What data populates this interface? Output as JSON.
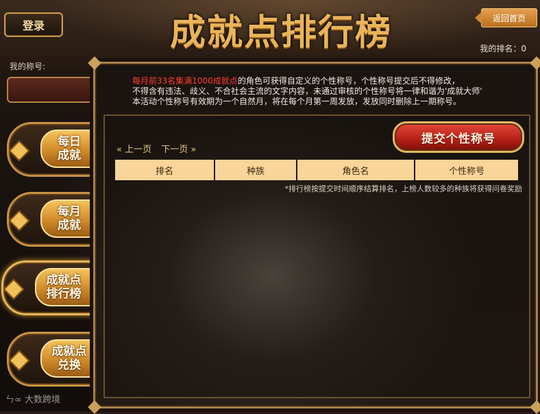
{
  "header": {
    "login_label": "登录",
    "title": "成就点排行榜",
    "home_label": "返回首页",
    "my_rank_label": "我的排名：",
    "my_rank_value": "0"
  },
  "sidebar": {
    "my_title_label": "我的称号:",
    "items": [
      {
        "line1": "每日",
        "line2": "成就"
      },
      {
        "line1": "每月",
        "line2": "成就"
      },
      {
        "line1": "成就点",
        "line2": "排行榜"
      },
      {
        "line1": "成就点",
        "line2": "兑换"
      }
    ]
  },
  "notice": {
    "highlight": "每月前33名集满1000成就点",
    "text1": "的角色可获得自定义的个性称号，个性称号提交后不得修改，",
    "line2": "不得含有违法、歧义、不合社会主流的文字内容，未通过审核的个性称号将一律和谐为'成就大师'",
    "line3": "本活动个性称号有效期为一个自然月，将在每个月第一周发放，发放同时删除上一期称号。"
  },
  "board": {
    "submit_label": "提交个性称号",
    "prev_label": "« 上一页",
    "next_label": "下一页 »",
    "columns": [
      "排名",
      "种族",
      "角色名",
      "个性称号"
    ],
    "footnote": "*排行榜按提交时间顺序结算排名，上榜人数较多的种族将获得问卷奖励"
  },
  "watermark": "大数跨境"
}
